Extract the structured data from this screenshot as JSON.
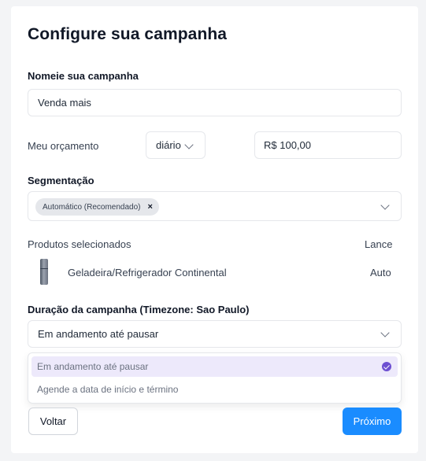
{
  "page": {
    "title": "Configure sua campanha"
  },
  "name_section": {
    "label": "Nomeie sua campanha",
    "value": "Venda mais"
  },
  "budget": {
    "label": "Meu orçamento",
    "period": "diário",
    "amount": "R$ 100,00"
  },
  "segmentation": {
    "label": "Segmentação",
    "chip": "Automático (Recomendado)",
    "chip_remove": "×"
  },
  "products": {
    "header": "Produtos selecionados",
    "bid_header": "Lance",
    "items": [
      {
        "name": "Geladeira/Refrigerador Continental",
        "bid": "Auto"
      }
    ]
  },
  "duration": {
    "label": "Duração da campanha (Timezone: Sao Paulo)",
    "selected": "Em andamento até pausar",
    "options": [
      {
        "label": "Em andamento até pausar",
        "selected": true
      },
      {
        "label": "Agende a data de início e término",
        "selected": false
      }
    ]
  },
  "footer": {
    "back_label": "Voltar",
    "next_label": "Próximo"
  },
  "colors": {
    "primary": "#1a8cff",
    "accent_purple": "#6d4fd1",
    "selected_bg": "#ede9fb"
  }
}
